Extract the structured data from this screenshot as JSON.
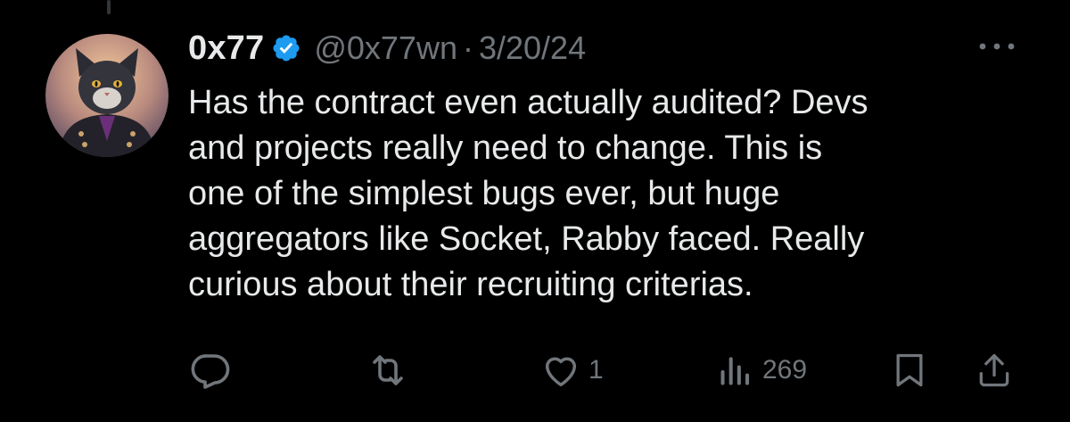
{
  "author": {
    "display_name": "0x77",
    "handle": "@0x77wn",
    "separator": "·",
    "date": "3/20/24",
    "verified": true
  },
  "tweet": {
    "lines": [
      "Has the contract even actually audited? Devs",
      "and projects really need to change. This is",
      "one of the simplest bugs ever, but huge",
      "aggregators like Socket, Rabby faced. Really",
      "curious about their recruiting criterias."
    ]
  },
  "actions": {
    "reply": {
      "icon": "reply-icon",
      "count": ""
    },
    "retweet": {
      "icon": "retweet-icon",
      "count": ""
    },
    "like": {
      "icon": "heart-icon",
      "count": "1"
    },
    "views": {
      "icon": "views-icon",
      "count": "269"
    },
    "bookmark": {
      "icon": "bookmark-icon"
    },
    "share": {
      "icon": "share-icon"
    }
  },
  "colors": {
    "background": "#000000",
    "primary_text": "#e7e9ea",
    "secondary_text": "#71767b",
    "verified_badge": "#1d9bf0"
  }
}
